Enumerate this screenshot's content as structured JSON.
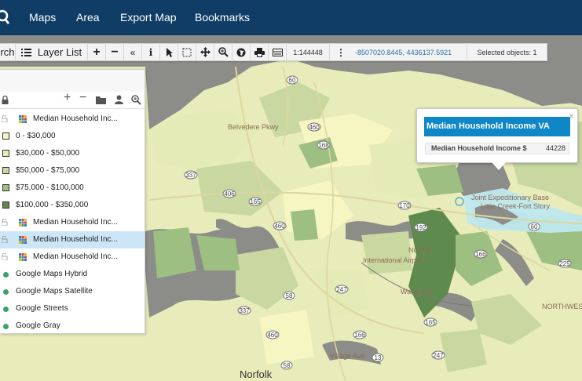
{
  "nav": {
    "menu": [
      "Maps",
      "Area",
      "Export Map",
      "Bookmarks"
    ]
  },
  "toolbar": {
    "search_label": "rch",
    "layer_list_label": "Layer List",
    "scale": "1:144448",
    "coordinates": "-8507020.8445, 4436137.5921",
    "selected_objects": "Selected objects: 1"
  },
  "layers": {
    "items": [
      {
        "type": "layer",
        "label": "Median Household Inc...",
        "selected": false
      },
      {
        "type": "legend",
        "label": "0 - $30,000",
        "color": "#f6f6c2"
      },
      {
        "type": "legend",
        "label": "$30,000 - $50,000",
        "color": "#e5ebb6"
      },
      {
        "type": "legend",
        "label": "$50,000 - $75,000",
        "color": "#c8d8a0"
      },
      {
        "type": "legend",
        "label": "$75,000 - $100,000",
        "color": "#9dbf82"
      },
      {
        "type": "legend",
        "label": "$100,000 - $350,000",
        "color": "#5f8a4e"
      },
      {
        "type": "layer",
        "label": "Median Household Inc...",
        "selected": false
      },
      {
        "type": "layer",
        "label": "Median Household Inc...",
        "selected": true
      },
      {
        "type": "layer",
        "label": "Median Household Inc...",
        "selected": false
      },
      {
        "type": "basemap",
        "label": "Google Maps Hybrid"
      },
      {
        "type": "basemap",
        "label": "Google Maps Satellite"
      },
      {
        "type": "basemap",
        "label": "Google Streets"
      },
      {
        "type": "basemap",
        "label": "Google Gray"
      }
    ]
  },
  "popup": {
    "title": "Median Household Income VA",
    "field_label": "Median Household Income $",
    "field_value": "44228",
    "close": "×"
  },
  "map": {
    "city_label": "Norfolk",
    "places": [
      "Norfolk",
      "International Airport",
      "Joint Expeditionary Base",
      "Little Creek-Fort Story",
      "NORTHWEST",
      "Belvedere Pkwy",
      "Village Ave",
      "Wards Rd"
    ],
    "highways": [
      "60",
      "460",
      "168",
      "337",
      "406",
      "165",
      "170",
      "192",
      "60",
      "166",
      "225",
      "247",
      "460",
      "165",
      "58",
      "337",
      "460",
      "166",
      "58",
      "13",
      "247"
    ],
    "colors": {
      "water": "#8c8c88",
      "class_1": "#f6f6c2",
      "class_2": "#e5ebb6",
      "class_3": "#c8d8a0",
      "class_4": "#9dbf82",
      "class_5": "#5f8a4e",
      "selection": "#bfe9ee"
    }
  }
}
